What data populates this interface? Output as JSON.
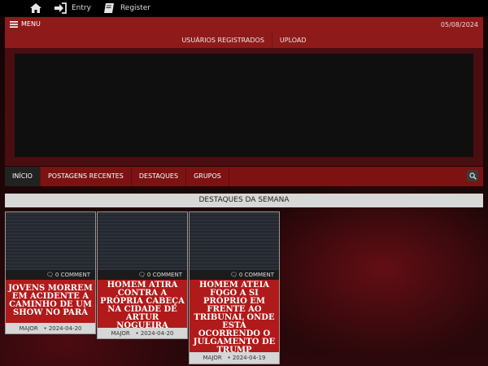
{
  "topbar": {
    "home_icon": "home-icon",
    "entry_label": "Entry",
    "register_label": "Register"
  },
  "header": {
    "menu_label": "MENU",
    "date": "05/08/2024",
    "links": [
      "USUÁRIOS REGISTRADOS",
      "UPLOAD"
    ]
  },
  "nav": {
    "items": [
      "INÍCIO",
      "POSTAGENS RECENTES",
      "DESTAQUES",
      "GRUPOS"
    ],
    "active": "INÍCIO"
  },
  "section": {
    "title": "DESTAQUES DA SEMANA"
  },
  "cards": [
    {
      "comments": "0 COMMENT",
      "title": "JOVENS MORREM EM ACIDENTE A CAMINHO DE UM SHOW NO PARÁ",
      "author": "MAJOR",
      "date": "2024-04-20"
    },
    {
      "comments": "0 COMMENT",
      "title": "HOMEM ATIRA CONTRA A PRÓPRIA CABEÇA NA CIDADE DE ARTUR NOGUEIRA",
      "author": "MAJOR",
      "date": "2024-04-20"
    },
    {
      "comments": "0 COMMENT",
      "title": "HOMEM ATEIA FOGO A SI PRÓPRIO EM FRENTE AO TRIBUNAL ONDE ESTÁ OCORRENDO O JULGAMENTO DE TRUMP",
      "author": "MAJOR",
      "date": "2024-04-19"
    }
  ],
  "colors": {
    "header_red": "#8e1a1a",
    "nav_red": "#7d1212",
    "card_title_red": "#b01a1a"
  }
}
